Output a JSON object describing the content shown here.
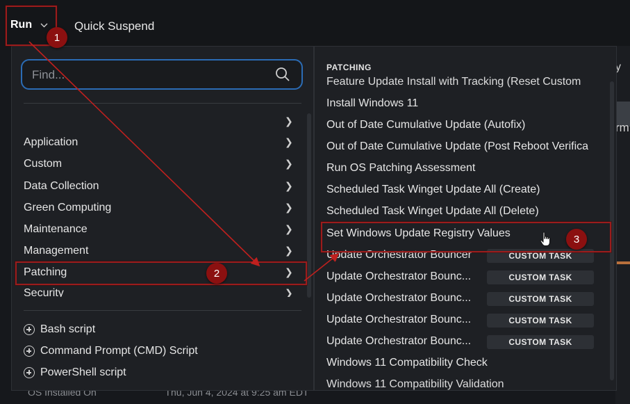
{
  "topbar": {
    "run_label": "Run",
    "quick_suspend_label": "Quick Suspend"
  },
  "background": {
    "right_edge_text_1": "y",
    "right_edge_text_2": "rm",
    "bottom_text_1": "OS Installed On",
    "bottom_text_2": "Thu, Jun 4, 2024 at 9:25 am EDT"
  },
  "search": {
    "placeholder": "Find..."
  },
  "categories": [
    {
      "label": ""
    },
    {
      "label": "Application"
    },
    {
      "label": "Custom"
    },
    {
      "label": "Data Collection"
    },
    {
      "label": "Green Computing"
    },
    {
      "label": "Maintenance"
    },
    {
      "label": "Management"
    },
    {
      "label": "Patching"
    },
    {
      "label": "Security"
    }
  ],
  "scripts": [
    {
      "label": "Bash script"
    },
    {
      "label": "Command Prompt (CMD) Script"
    },
    {
      "label": "PowerShell script"
    }
  ],
  "patching": {
    "section_title": "PATCHING",
    "tasks": [
      {
        "label": "Feature Update Install with Tracking (Reset Custom",
        "tag": ""
      },
      {
        "label": "Install Windows 11",
        "tag": ""
      },
      {
        "label": "Out of Date Cumulative Update (Autofix)",
        "tag": ""
      },
      {
        "label": "Out of Date Cumulative Update (Post Reboot Verifica",
        "tag": ""
      },
      {
        "label": "Run OS Patching Assessment",
        "tag": ""
      },
      {
        "label": "Scheduled Task Winget Update All (Create)",
        "tag": ""
      },
      {
        "label": "Scheduled Task Winget Update All (Delete)",
        "tag": ""
      },
      {
        "label": "Set Windows Update Registry Values",
        "tag": ""
      },
      {
        "label": "Update Orchestrator Bouncer",
        "tag": "CUSTOM TASK"
      },
      {
        "label": "Update Orchestrator Bounc...",
        "tag": "CUSTOM TASK"
      },
      {
        "label": "Update Orchestrator Bounc...",
        "tag": "CUSTOM TASK"
      },
      {
        "label": "Update Orchestrator Bounc...",
        "tag": "CUSTOM TASK"
      },
      {
        "label": "Update Orchestrator Bounc...",
        "tag": "CUSTOM TASK"
      },
      {
        "label": "Windows 11 Compatibility Check",
        "tag": ""
      },
      {
        "label": "Windows 11 Compatibility Validation",
        "tag": ""
      }
    ]
  },
  "annotations": {
    "step_1": "1",
    "step_2": "2",
    "step_3": "3",
    "accent_red": "#9b1c1c",
    "accent_blue": "#2b6cb5"
  }
}
